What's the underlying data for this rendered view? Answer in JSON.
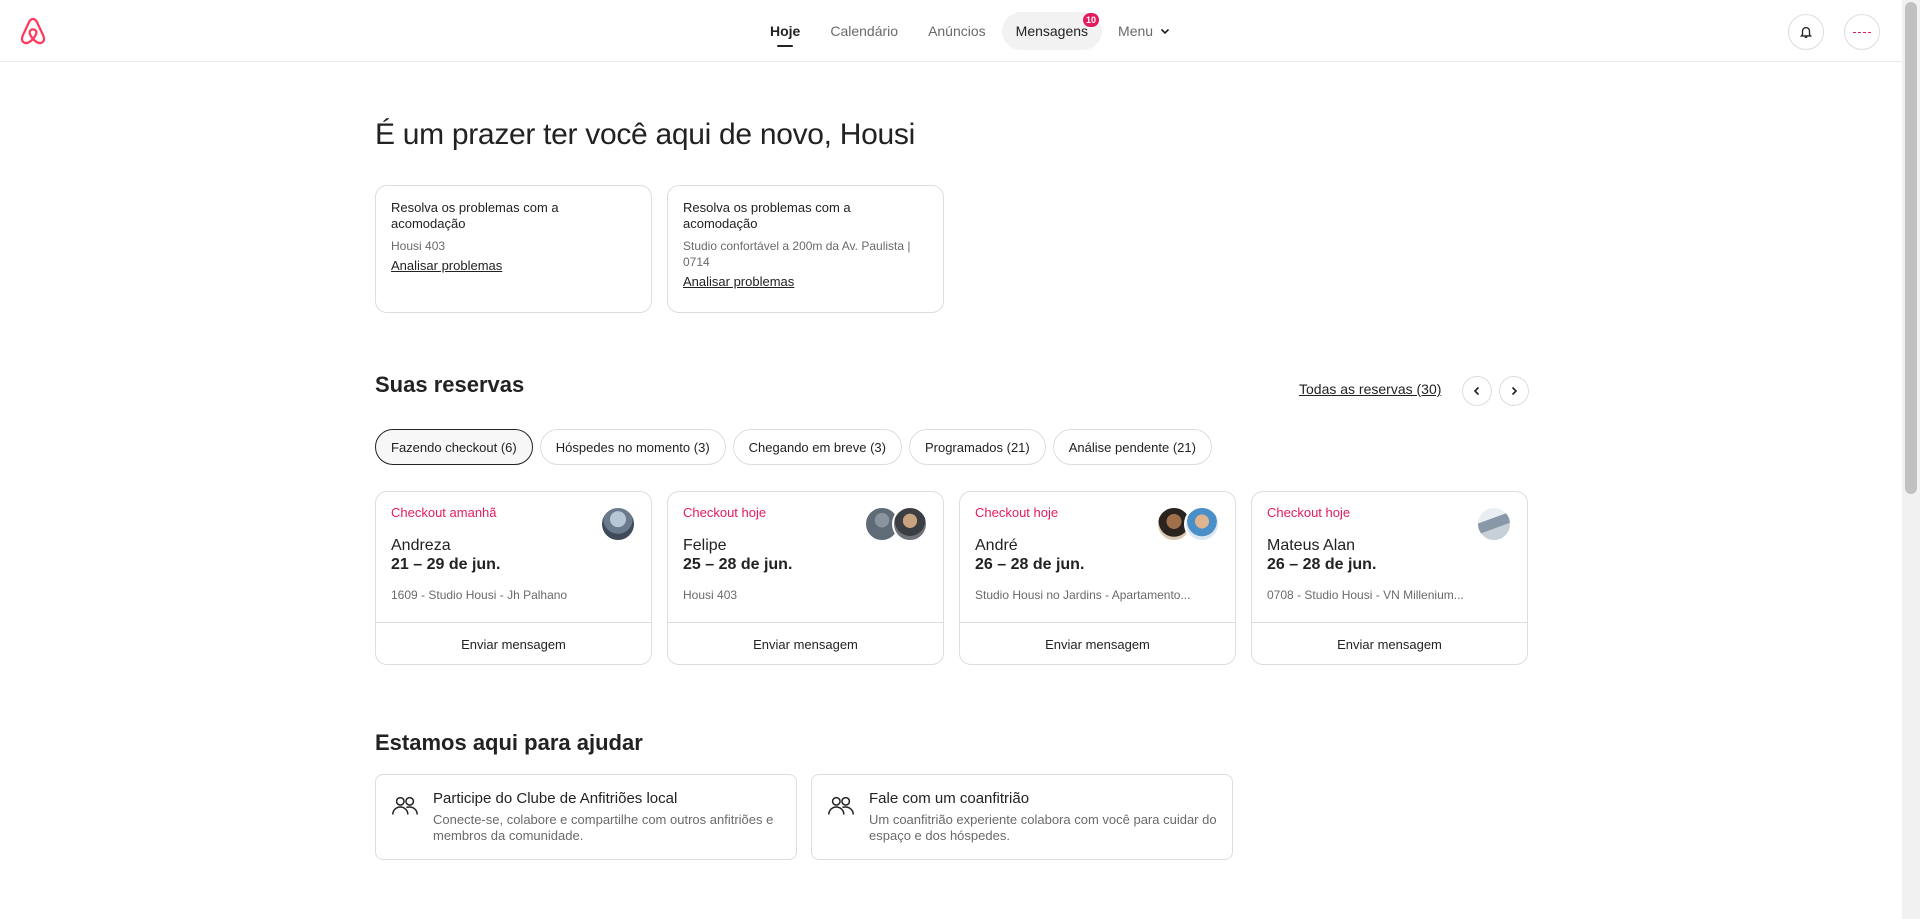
{
  "nav": {
    "items": [
      {
        "label": "Hoje"
      },
      {
        "label": "Calendário"
      },
      {
        "label": "Anúncios"
      },
      {
        "label": "Mensagens",
        "badge": "10"
      },
      {
        "label": "Menu"
      }
    ]
  },
  "greeting": "É um prazer ter você aqui de novo, Housi",
  "issues": [
    {
      "title": "Resolva os problemas com a acomodação",
      "subtitle": "Housi 403",
      "link": "Analisar problemas"
    },
    {
      "title": "Resolva os problemas com a acomodação",
      "subtitle": "Studio confortável a 200m da Av. Paulista | 0714",
      "link": "Analisar problemas"
    }
  ],
  "reservations": {
    "title": "Suas reservas",
    "all_link": "Todas as reservas (30)",
    "chips": [
      "Fazendo checkout (6)",
      "Hóspedes no momento (3)",
      "Chegando em breve (3)",
      "Programados (21)",
      "Análise pendente (21)"
    ],
    "cards": [
      {
        "status": "Checkout amanhã",
        "name": "Andreza",
        "dates": "21 – 29 de jun.",
        "place": "1609 - Studio Housi - Jh Palhano",
        "button": "Enviar mensagem"
      },
      {
        "status": "Checkout hoje",
        "name": "Felipe",
        "dates": "25 – 28 de jun.",
        "place": "Housi 403",
        "button": "Enviar mensagem"
      },
      {
        "status": "Checkout hoje",
        "name": "André",
        "dates": "26 – 28 de jun.",
        "place": "Studio Housi no Jardins - Apartamento...",
        "button": "Enviar mensagem"
      },
      {
        "status": "Checkout hoje",
        "name": "Mateus Alan",
        "dates": "26 – 28 de jun.",
        "place": "0708 - Studio Housi - VN Millenium...",
        "button": "Enviar mensagem"
      }
    ]
  },
  "help": {
    "title": "Estamos aqui para ajudar",
    "cards": [
      {
        "title": "Participe do Clube de Anfitriões local",
        "desc": "Conecte-se, colabore e compartilhe com outros anfitriões e membros da comunidade."
      },
      {
        "title": "Fale com um coanfitrião",
        "desc": "Um coanfitrião experiente colabora com você para cuidar do espaço e dos hóspedes."
      }
    ]
  },
  "colors": {
    "brand": "#ff385c",
    "status": "#e31c5f",
    "text": "#222222",
    "muted": "#6a6a6a",
    "border": "#dddddd"
  },
  "icons": [
    "airbnb-logo-icon",
    "chevron-down-icon",
    "bell-icon",
    "chevron-left-icon",
    "chevron-right-icon",
    "people-icon"
  ]
}
